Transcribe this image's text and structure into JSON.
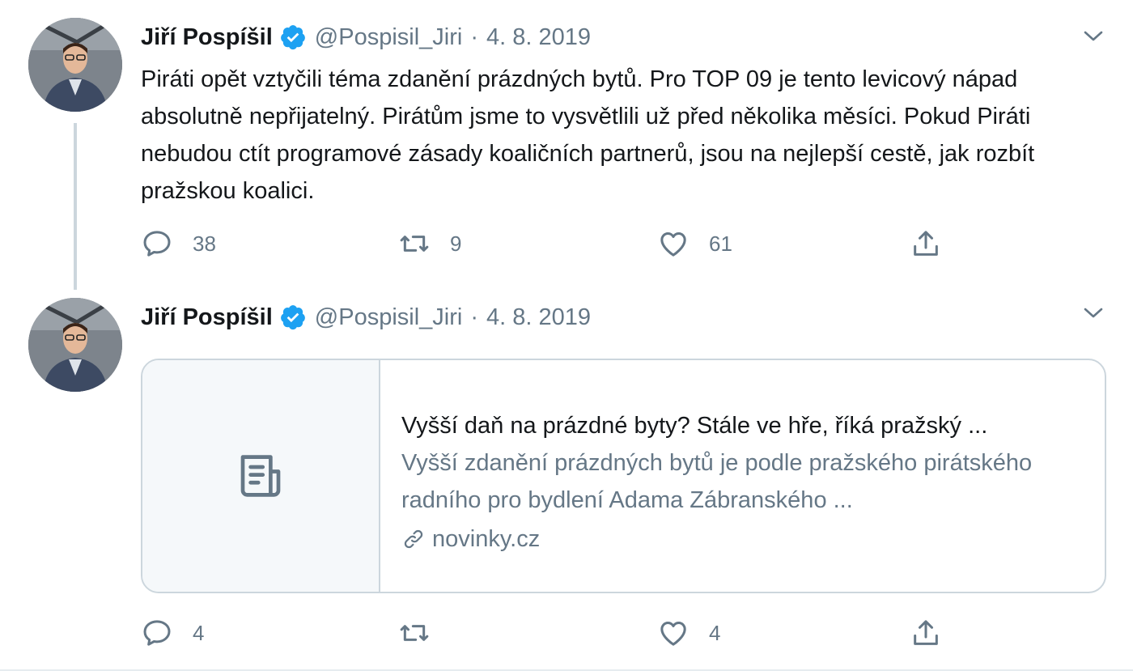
{
  "tweets": [
    {
      "author_name": "Jiří Pospíšil",
      "handle": "@Pospisil_Jiri",
      "separator": "·",
      "date": "4. 8. 2019",
      "text": "Piráti opět vztyčili téma zdanění prázdných bytů. Pro TOP 09 je tento levicový nápad absolutně nepřijatelný. Pirátům jsme to vysvětlili už před několika měsíci. Pokud Piráti nebudou ctít programové zásady koaličních partnerů, jsou na nejlepší cestě, jak rozbít pražskou koalici.",
      "replies": "38",
      "retweets": "9",
      "likes": "61"
    },
    {
      "author_name": "Jiří Pospíšil",
      "handle": "@Pospisil_Jiri",
      "separator": "·",
      "date": "4. 8. 2019",
      "card": {
        "title": "Vyšší daň na prázdné byty? Stále ve hře, říká pražský ...",
        "description": "Vyšší zdanění prázdných bytů je podle pražského pirátského radního pro bydlení Adama Zábranského ...",
        "domain": "novinky.cz"
      },
      "replies": "4",
      "retweets": "",
      "likes": "4"
    }
  ],
  "icons": {
    "verified": "verified-badge-icon",
    "caret": "chevron-down-icon",
    "reply": "reply-icon",
    "retweet": "retweet-icon",
    "like": "heart-icon",
    "share": "share-icon",
    "card_placeholder": "document-icon",
    "link": "link-icon"
  },
  "colors": {
    "verified_blue": "#1da1f2",
    "secondary_text": "#657786",
    "border": "#ccd6dd"
  }
}
